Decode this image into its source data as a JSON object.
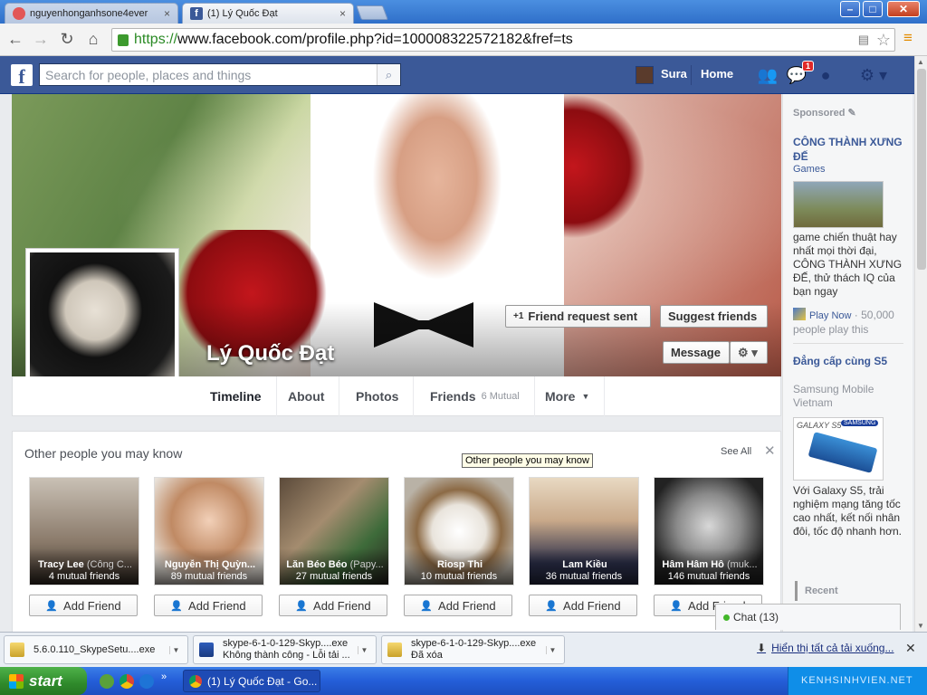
{
  "browser": {
    "tabs": [
      {
        "label": "nguyenhonganhsone4ever",
        "close": "×"
      },
      {
        "label": "(1) Lý Quốc Đạt",
        "close": "×"
      }
    ],
    "url_scheme": "https://",
    "url_rest": "www.facebook.com/profile.php?id=100008322572182&fref=ts",
    "window_buttons": {
      "min": "–",
      "max": "□",
      "close": "✕"
    }
  },
  "fb_header": {
    "logo": "f",
    "search_placeholder": "Search for people, places and things",
    "user_name": "Sura",
    "home": "Home",
    "notification_count": "1",
    "icons": [
      "search-icon",
      "friend-requests-icon",
      "messages-icon",
      "notifications-icon",
      "privacy-icon",
      "settings-icon"
    ]
  },
  "profile": {
    "name": "Lý Quốc Đạt",
    "friend_request_sent": "Friend request sent",
    "suggest_friends": "Suggest friends",
    "message": "Message",
    "tabs": {
      "timeline": "Timeline",
      "about": "About",
      "photos": "Photos",
      "friends": "Friends",
      "friends_mutual": "6 Mutual",
      "more": "More"
    }
  },
  "pymk": {
    "title": "Other people you may know",
    "see_all": "See All",
    "tooltip": "Other people you may know",
    "add_friend": "Add Friend",
    "people": [
      {
        "name": "Tracy Lee",
        "alt": "(Công C...",
        "mutual": "4 mutual friends"
      },
      {
        "name": "Nguyễn Thị Quỳn...",
        "alt": "",
        "mutual": "89 mutual friends"
      },
      {
        "name": "Lăn Béo Béo",
        "alt": "(Papy...",
        "mutual": "27 mutual friends"
      },
      {
        "name": "Riosp Thi",
        "alt": "",
        "mutual": "10 mutual friends"
      },
      {
        "name": "Lam Kiều",
        "alt": "",
        "mutual": "36 mutual friends"
      },
      {
        "name": "Hâm Hâm Hô",
        "alt": "(muk...",
        "mutual": "146 mutual friends"
      }
    ]
  },
  "sidebar": {
    "sponsored": "Sponsored",
    "ad1": {
      "title": "CÔNG THÀNH XƯNG ĐẾ",
      "category": "Games",
      "desc": "game chiến thuật hay nhất mọi thời đại, CÔNG THÀNH XƯNG ĐẾ, thử thách IQ của bạn ngay",
      "play": "Play Now",
      "stat": " · 50,000 people play this"
    },
    "ad2": {
      "title": "Đẳng cấp cùng S5",
      "advertiser": "Samsung Mobile Vietnam",
      "img_galaxy": "GALAXY S5",
      "img_brand": "SAMSUNG",
      "desc": "Với Galaxy S5, trải nghiệm mạng tăng tốc cao nhất, kết nối nhân đôi, tốc độ nhanh hơn."
    },
    "recent": "Recent",
    "chat": "Chat (13)"
  },
  "downloads": {
    "items": [
      {
        "line1": "5.6.0.110_SkypeSetu....exe",
        "line2": ""
      },
      {
        "line1": "skype-6-1-0-129-Skyp....exe",
        "line2": "Không thành công - Lỗi tải ..."
      },
      {
        "line1": "skype-6-1-0-129-Skyp....exe",
        "line2": "Đã xóa"
      }
    ],
    "show_all": "Hiển thị tất cả tải xuống..."
  },
  "taskbar": {
    "start": "start",
    "task": "(1) Lý Quốc Đạt - Go...",
    "tray": "KENHSINHVIEN.NET"
  }
}
